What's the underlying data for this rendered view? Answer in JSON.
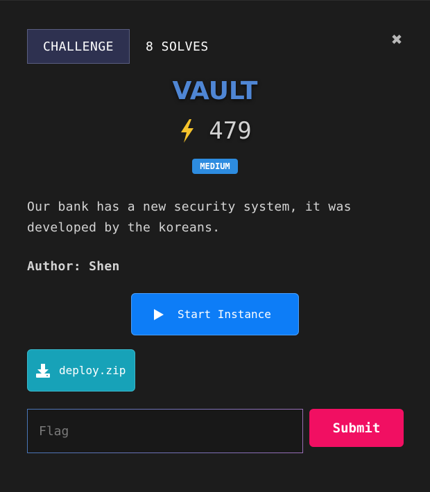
{
  "header": {
    "tab_challenge": "CHALLENGE",
    "tab_solves": "8 SOLVES",
    "close_glyph": "✖"
  },
  "challenge": {
    "title": "VAULT",
    "points": "479",
    "difficulty": "MEDIUM",
    "description": "Our bank has a new security system, it was developed by the koreans.",
    "author": "Author: Shen"
  },
  "actions": {
    "start_instance_label": "Start Instance",
    "download_label": "deploy.zip"
  },
  "flag_form": {
    "placeholder": "Flag",
    "value": "",
    "submit_label": "Submit"
  },
  "icons": {
    "close": "close-icon",
    "bolt": "lightning-bolt-icon",
    "play": "play-icon",
    "download": "download-icon"
  },
  "colors": {
    "title": "#4f86d4",
    "bolt": "#f5c32c",
    "difficulty_badge": "#2d8ce0",
    "start_button": "#0d7df7",
    "download_button": "#17a2b8",
    "submit_button": "#f10f62",
    "challenge_tab": "#2e3150"
  }
}
